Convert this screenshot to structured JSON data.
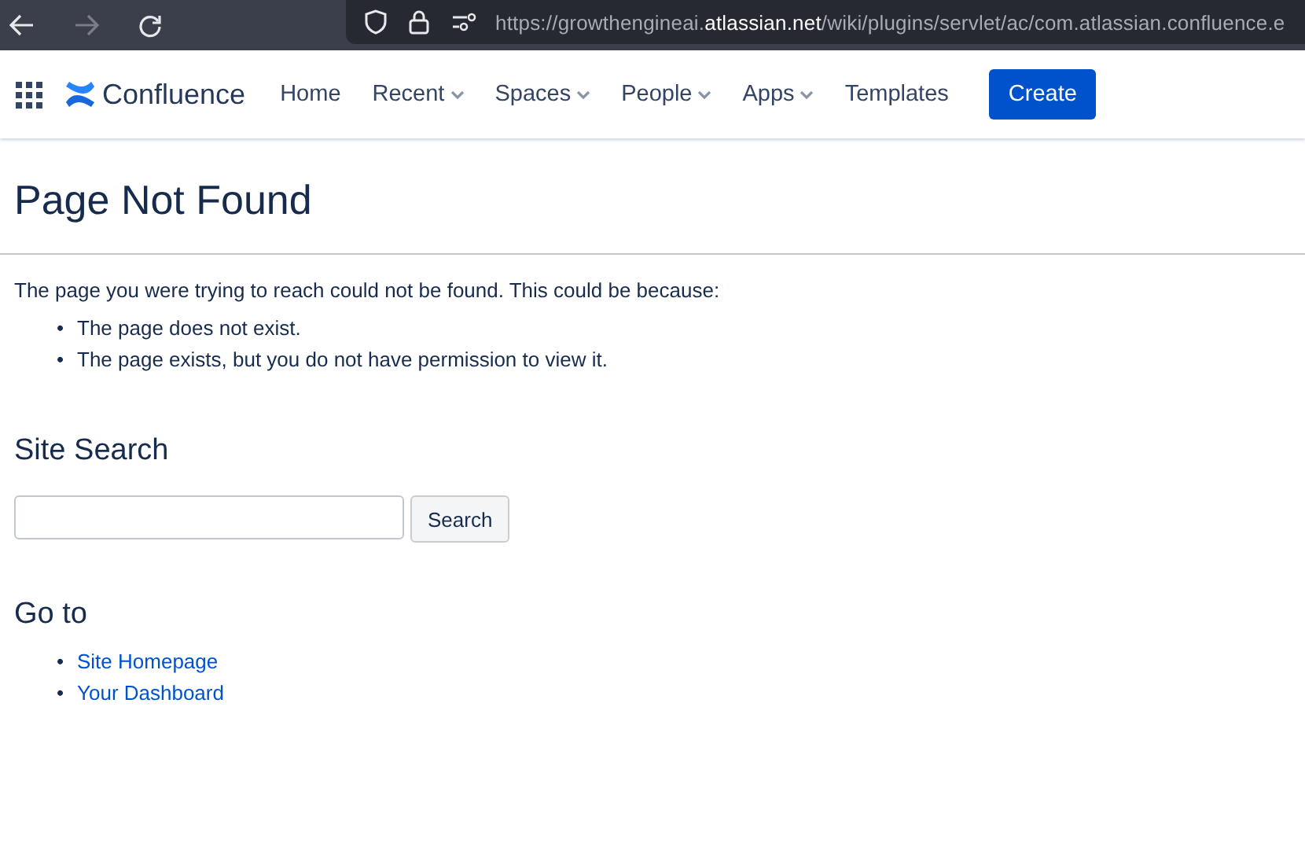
{
  "browser": {
    "url": {
      "prefix": "https://growthengineai.",
      "domain": "atlassian.net",
      "path": "/wiki/plugins/servlet/ac/com.atlassian.confluence.e"
    },
    "forward_disabled": true
  },
  "header": {
    "product": "Confluence",
    "nav": [
      {
        "label": "Home",
        "has_menu": false
      },
      {
        "label": "Recent",
        "has_menu": true
      },
      {
        "label": "Spaces",
        "has_menu": true
      },
      {
        "label": "People",
        "has_menu": true
      },
      {
        "label": "Apps",
        "has_menu": true
      },
      {
        "label": "Templates",
        "has_menu": false
      }
    ],
    "create_button": "Create"
  },
  "title": "Page Not Found",
  "intro": "The page you were trying to reach could not be found. This could be because:",
  "reasons": [
    {
      "bullet": "•",
      "text": "The page does not exist."
    },
    {
      "bullet": "•",
      "text": "The page exists, but you do not have permission to view it."
    }
  ],
  "search": {
    "heading": "Site Search",
    "button": "Search"
  },
  "goto": {
    "heading": "Go to",
    "links": [
      {
        "bullet": "•",
        "text": "Site Homepage"
      },
      {
        "bullet": "•",
        "text": "Your Dashboard"
      }
    ]
  }
}
